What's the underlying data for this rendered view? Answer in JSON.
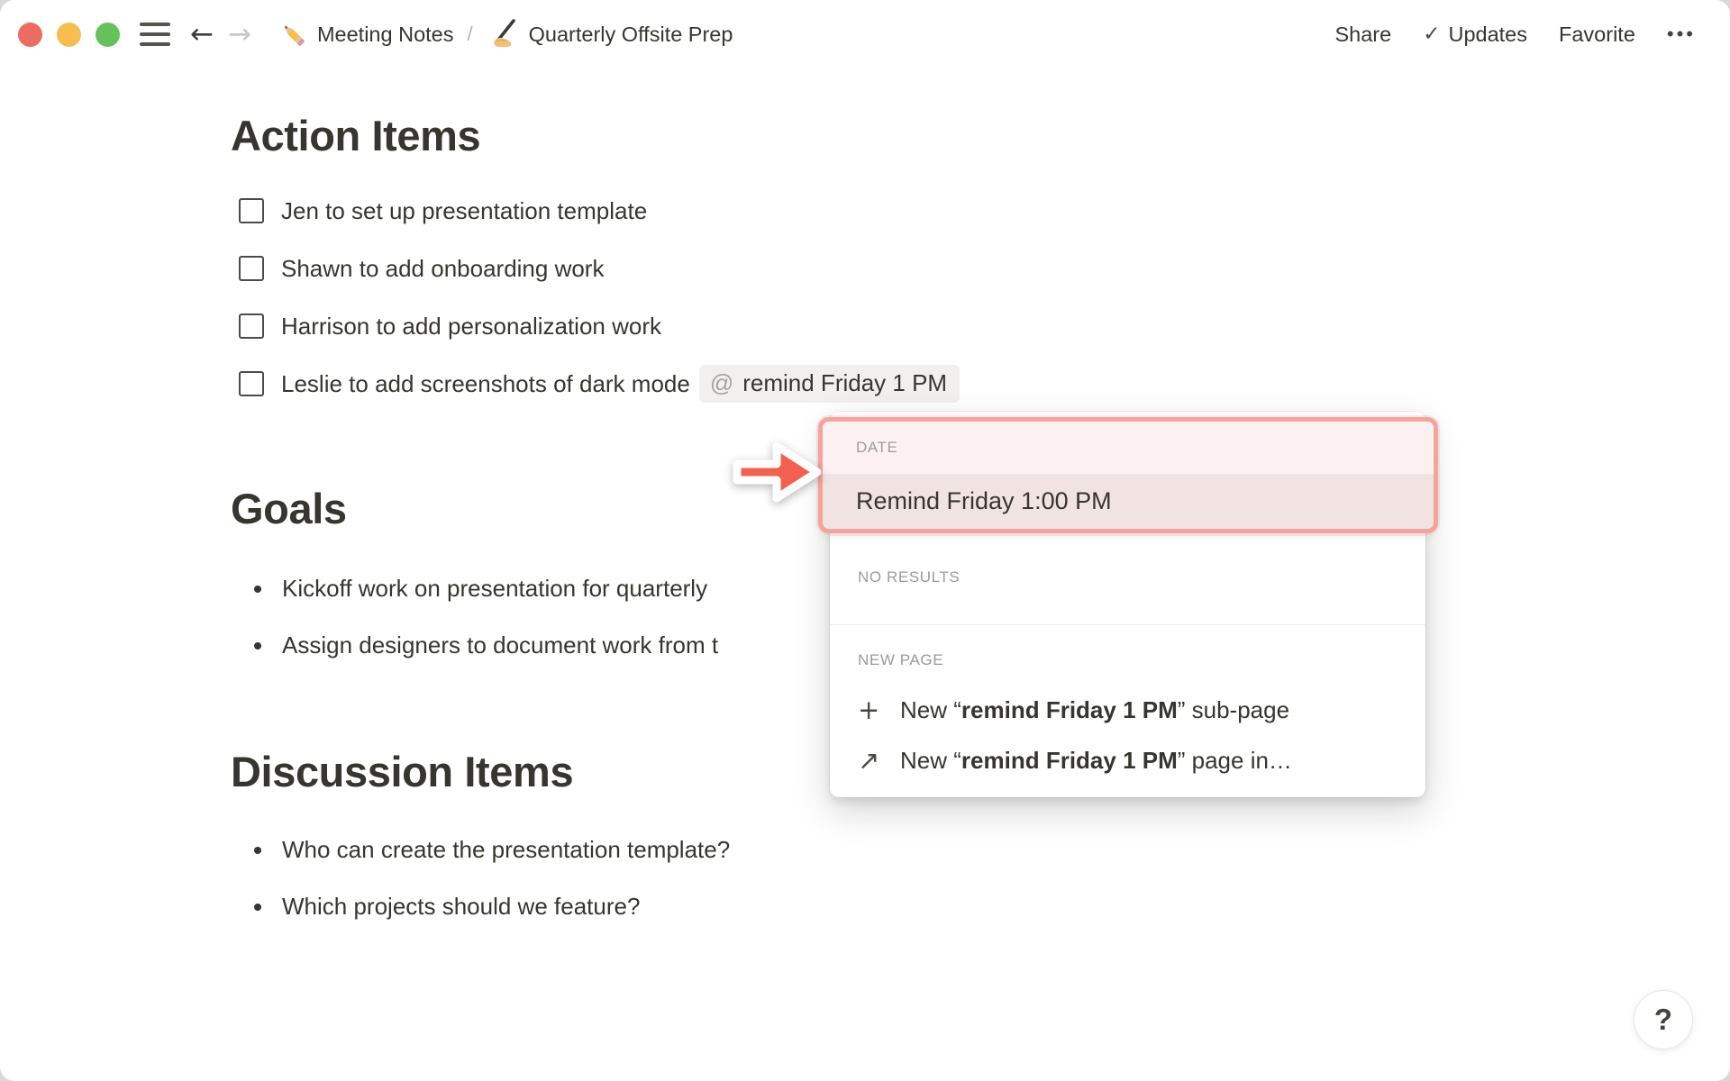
{
  "topbar": {
    "nav": {
      "back": "←",
      "forward": "→"
    },
    "breadcrumb": {
      "page1_icon": "pencil-emoji",
      "page1": "Meeting Notes",
      "separator": "/",
      "page2_icon": "writing-hand-emoji",
      "page2": "Quarterly Offsite Prep"
    },
    "actions": {
      "share": "Share",
      "updates_check": "✓",
      "updates": "Updates",
      "favorite": "Favorite",
      "more": "•••"
    }
  },
  "document": {
    "action_items": {
      "heading": "Action Items",
      "todos": [
        {
          "label": "Jen to set up presentation template"
        },
        {
          "label": "Shawn to add onboarding work"
        },
        {
          "label": "Harrison to add personalization work"
        },
        {
          "label": "Leslie to add screenshots of dark mode",
          "mention_at": "@",
          "mention_text": "remind Friday 1 PM"
        }
      ]
    },
    "goals": {
      "heading": "Goals",
      "bullets": [
        "Kickoff work on presentation for quarterly",
        "Assign designers to document work from t"
      ]
    },
    "discussion": {
      "heading": "Discussion Items",
      "bullets": [
        "Who can create the presentation template?",
        "Which projects should we feature?"
      ]
    }
  },
  "popup": {
    "date_section_label": "DATE",
    "date_result": "Remind Friday 1:00 PM",
    "no_results_label": "NO RESULTS",
    "new_page_label": "NEW PAGE",
    "new_subpage": {
      "prefix": "New “",
      "bold": "remind Friday 1 PM",
      "suffix": "” sub-page"
    },
    "new_page_in": {
      "prefix": "New “",
      "bold": "remind Friday 1 PM",
      "suffix": "” page in…"
    },
    "icons": {
      "plus": "+",
      "arrow_up_right": "↗"
    }
  },
  "help_button": "?",
  "colors": {
    "accent_arrow": "#f2604f",
    "annotation_border": "#f3a49c",
    "annotation_header_bg": "#fdf2f1",
    "annotation_selected_bg": "#f1e3e1",
    "mention_bg": "#f1f0ee",
    "text": "#37352f",
    "muted_label": "#9b9a97",
    "traffic_red": "#ed6b60",
    "traffic_yellow": "#f6be50",
    "traffic_green": "#65c25b"
  }
}
